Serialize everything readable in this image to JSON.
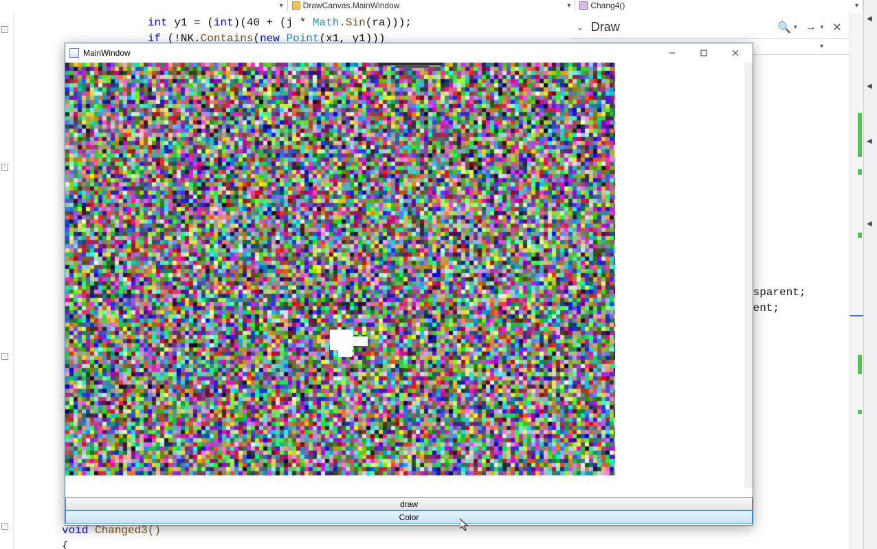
{
  "ide": {
    "combos": {
      "left": "",
      "middle_icon": "namespace-icon",
      "middle": "DrawCanvas.MainWindow",
      "right_icon": "method-icon",
      "right": "Chang4()"
    },
    "code_lines": {
      "l1_pre": "             ",
      "l1_int": "int",
      "l1_rest": " y1 = (",
      "l1_int2": "int",
      "l1_rest2": ")(40 + (j * ",
      "l1_math": "Math",
      "l1_sin": ".Sin",
      "l1_end": "(ra)));",
      "l2_pre": "             ",
      "l2_if": "if",
      "l2_mid": " (!NK.",
      "l2_contains": "Contains",
      "l2_paren": "(",
      "l2_new": "new",
      "l2_sp": " ",
      "l2_point": "Point",
      "l2_args": "(x1, y1)))"
    },
    "code_tail": {
      "t1": "nsparent;",
      "t2": "rent;"
    },
    "code_bottom": {
      "void": "void",
      "name": " Changed3()",
      "brace": "{"
    },
    "find": {
      "text": "Draw"
    }
  },
  "app": {
    "title": "MainWindow",
    "buttons": {
      "draw": "draw",
      "color": "Color"
    }
  }
}
